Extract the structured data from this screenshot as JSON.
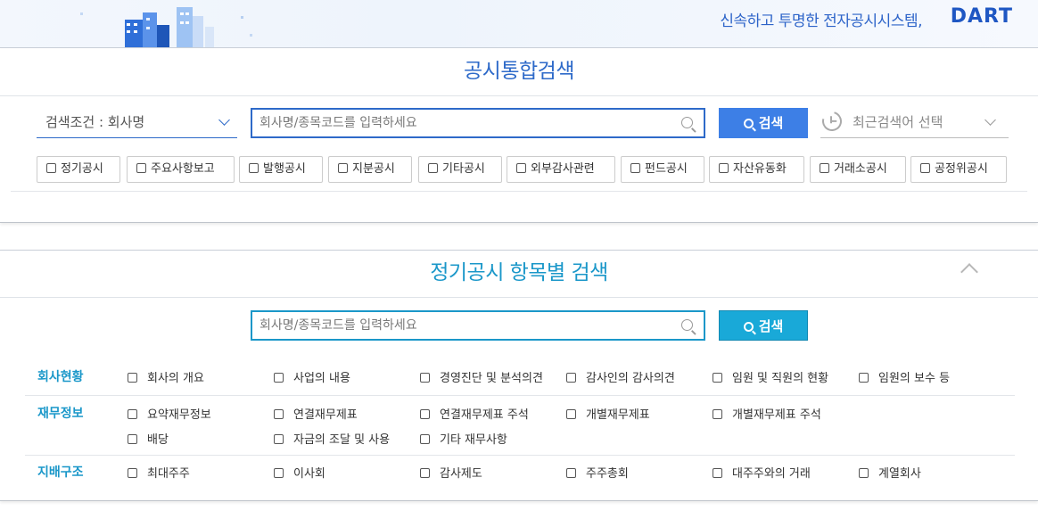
{
  "header": {
    "slogan": "신속하고 투명한 전자공시시스템,",
    "logo": "DART"
  },
  "integrated_search": {
    "title": "공시통합검색",
    "condition_label": "검색조건 : 회사명",
    "search_placeholder": "회사명/종목코드를 입력하세요",
    "search_button": "검색",
    "recent_placeholder": "최근검색어 선택",
    "filters": [
      "정기공시",
      "주요사항보고",
      "발행공시",
      "지분공시",
      "기타공시",
      "외부감사관련",
      "펀드공시",
      "자산유동화",
      "거래소공시",
      "공정위공시"
    ]
  },
  "periodic_search": {
    "title": "정기공시 항목별 검색",
    "search_placeholder": "회사명/종목코드를 입력하세요",
    "search_button": "검색",
    "categories": [
      {
        "name": "회사현황",
        "items": [
          "회사의 개요",
          "사업의 내용",
          "경영진단 및 분석의견",
          "감사인의 감사의견",
          "임원 및 직원의 현황",
          "임원의 보수 등"
        ]
      },
      {
        "name": "재무정보",
        "items": [
          "요약재무정보",
          "연결재무제표",
          "연결재무제표 주석",
          "개별재무제표",
          "개별재무제표 주석",
          "배당",
          "자금의 조달 및 사용",
          "기타 재무사항"
        ]
      },
      {
        "name": "지배구조",
        "items": [
          "최대주주",
          "이사회",
          "감사제도",
          "주주총회",
          "대주주와의 거래",
          "계열회사"
        ]
      }
    ]
  },
  "colors": {
    "primary_blue": "#2e6ac9",
    "search_button_blue": "#3d7fe6",
    "teal": "#1a97c9",
    "teal_button": "#19a9d8"
  }
}
